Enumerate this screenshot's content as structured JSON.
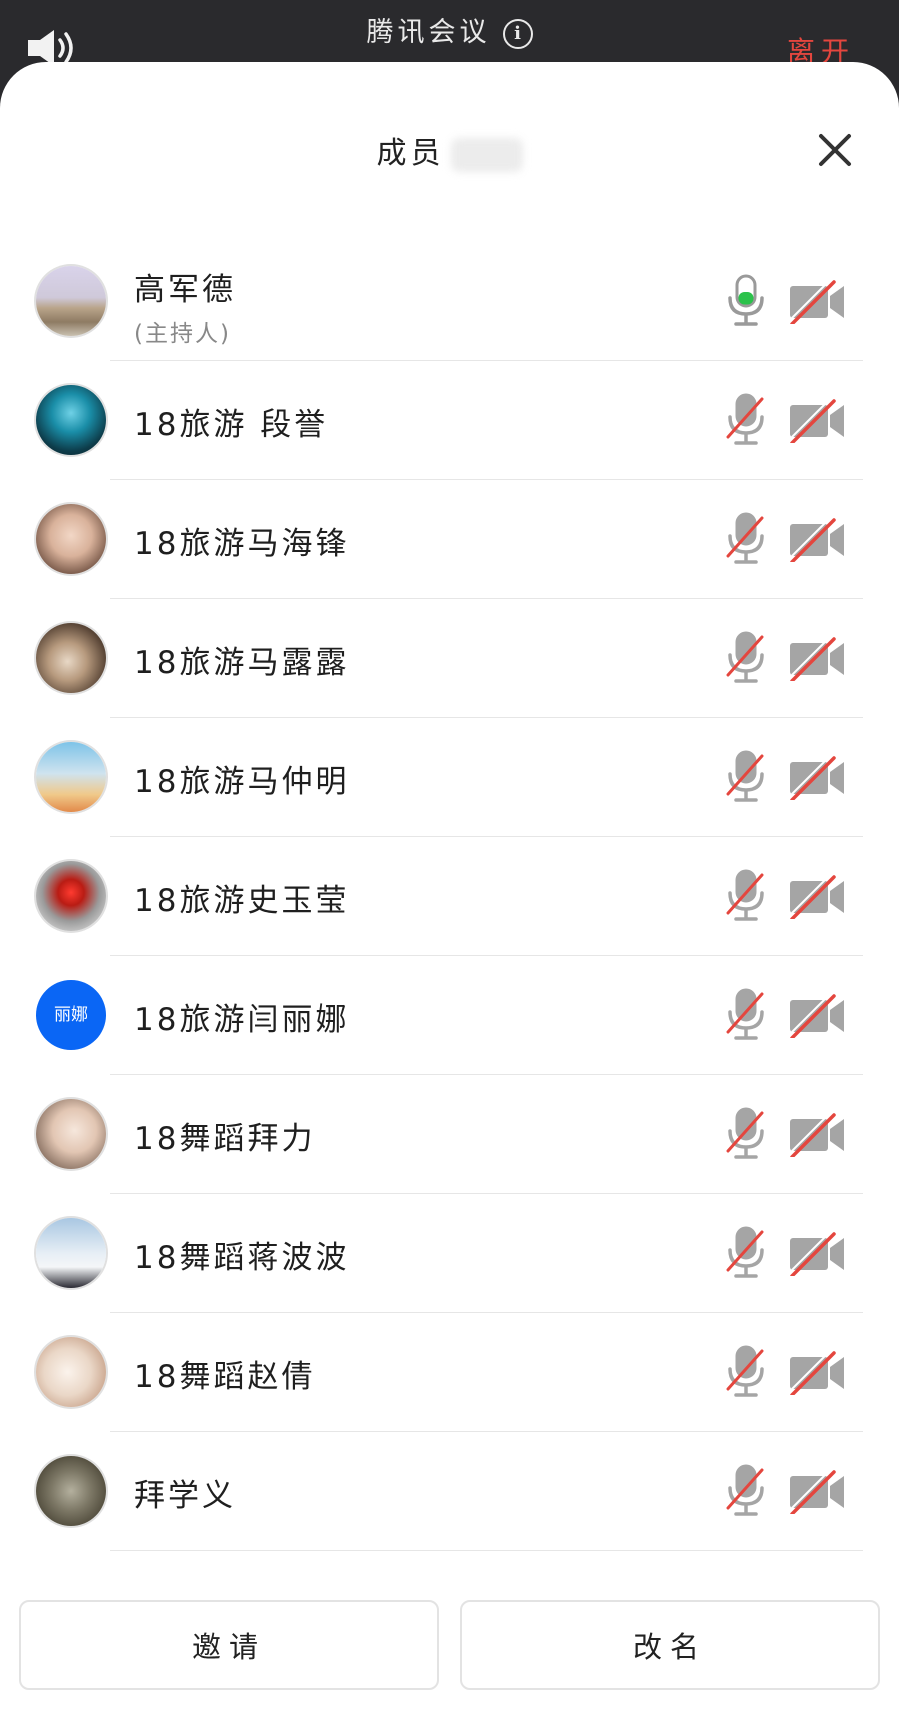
{
  "app": {
    "title": "腾讯会议",
    "leave_label": "离开"
  },
  "panel": {
    "title": "成员",
    "member_count_hidden": true
  },
  "colors": {
    "accent_red": "#e4463e",
    "active_green": "#2bc24b",
    "avatar_blue": "#0a66f5",
    "icon_gray": "#9a9a9a"
  },
  "members": [
    {
      "name": "高军德",
      "role": "(主持人)",
      "avatar_text": "",
      "mic": "active",
      "camera": "off"
    },
    {
      "name": "18旅游 段誉",
      "role": "",
      "avatar_text": "",
      "mic": "muted",
      "camera": "off"
    },
    {
      "name": "18旅游马海锋",
      "role": "",
      "avatar_text": "",
      "mic": "muted",
      "camera": "off"
    },
    {
      "name": "18旅游马露露",
      "role": "",
      "avatar_text": "",
      "mic": "muted",
      "camera": "off"
    },
    {
      "name": "18旅游马仲明",
      "role": "",
      "avatar_text": "",
      "mic": "muted",
      "camera": "off"
    },
    {
      "name": "18旅游史玉莹",
      "role": "",
      "avatar_text": "",
      "mic": "muted",
      "camera": "off"
    },
    {
      "name": "18旅游闫丽娜",
      "role": "",
      "avatar_text": "丽娜",
      "mic": "muted",
      "camera": "off"
    },
    {
      "name": "18舞蹈拜力",
      "role": "",
      "avatar_text": "",
      "mic": "muted",
      "camera": "off"
    },
    {
      "name": "18舞蹈蒋波波",
      "role": "",
      "avatar_text": "",
      "mic": "muted",
      "camera": "off"
    },
    {
      "name": "18舞蹈赵倩",
      "role": "",
      "avatar_text": "",
      "mic": "muted",
      "camera": "off"
    },
    {
      "name": "拜学义",
      "role": "",
      "avatar_text": "",
      "mic": "muted",
      "camera": "off"
    }
  ],
  "footer": {
    "invite_label": "邀请",
    "rename_label": "改名"
  },
  "icons": {
    "speaker": "speaker-icon",
    "info": "info-icon",
    "close": "close-icon",
    "mic": "microphone-icon",
    "camera_off": "camera-off-icon"
  }
}
